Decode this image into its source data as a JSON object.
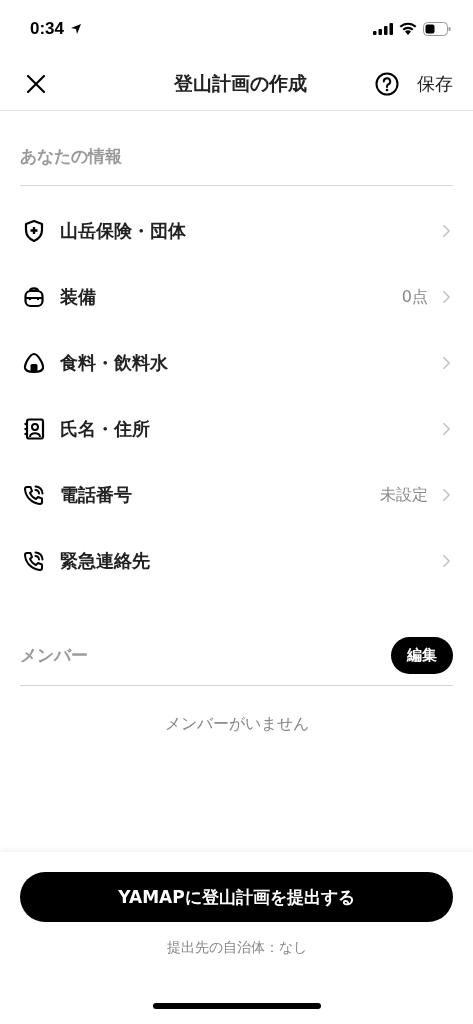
{
  "status_bar": {
    "time": "0:34"
  },
  "nav": {
    "title": "登山計画の作成",
    "save": "保存"
  },
  "your_info": {
    "heading": "あなたの情報",
    "items": [
      {
        "kind": "shield",
        "label": "山岳保険・団体"
      },
      {
        "kind": "backpack",
        "label": "装備",
        "value": "0点"
      },
      {
        "kind": "riceball",
        "label": "食料・飲料水"
      },
      {
        "kind": "contact",
        "label": "氏名・住所"
      },
      {
        "kind": "phone",
        "label": "電話番号",
        "value": "未設定"
      },
      {
        "kind": "phone",
        "label": "緊急連絡先"
      }
    ]
  },
  "members": {
    "heading": "メンバー",
    "edit": "編集",
    "empty": "メンバーがいません"
  },
  "footer": {
    "submit": "YAMAPに登山計画を提出する",
    "note": "提出先の自治体：なし"
  }
}
